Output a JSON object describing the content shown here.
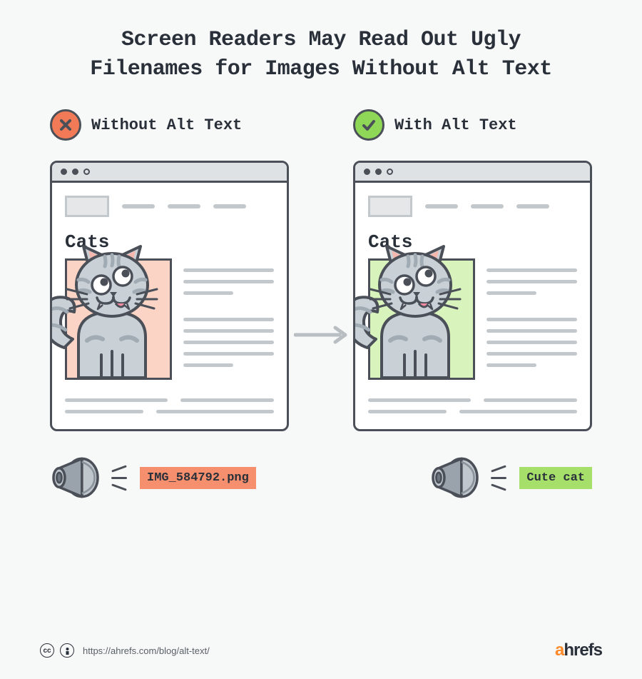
{
  "title_line1": "Screen Readers May Read Out Ugly",
  "title_line2": "Filenames for Images Without Alt Text",
  "left": {
    "label": "Without Alt Text",
    "page_heading": "Cats",
    "speaker_text": "IMG_584792.png"
  },
  "right": {
    "label": "With Alt Text",
    "page_heading": "Cats",
    "speaker_text": "Cute cat"
  },
  "footer": {
    "source_url": "https://ahrefs.com/blog/alt-text/",
    "brand": "ahrefs"
  }
}
